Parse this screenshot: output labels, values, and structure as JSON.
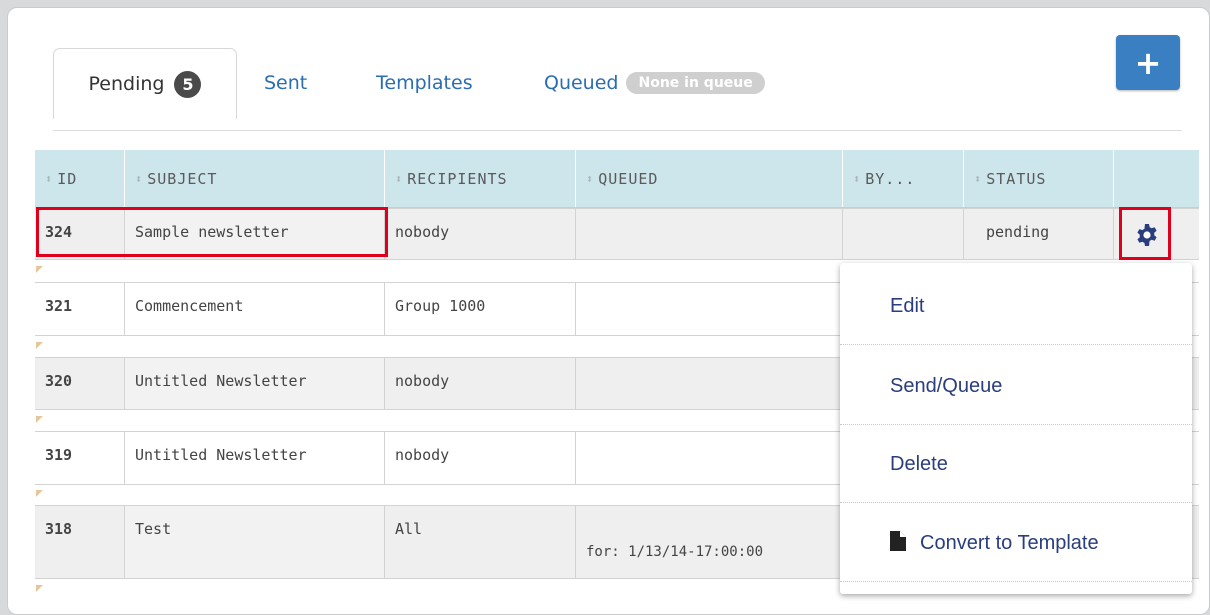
{
  "tabs": {
    "pending": {
      "label": "Pending",
      "count": "5"
    },
    "sent": {
      "label": "Sent"
    },
    "templates": {
      "label": "Templates"
    },
    "queued": {
      "label": "Queued",
      "pill": "None in queue"
    }
  },
  "add_button": {
    "label": "+"
  },
  "table": {
    "headers": [
      "ID",
      "SUBJECT",
      "RECIPIENTS",
      "QUEUED",
      "BY...",
      "STATUS"
    ],
    "rows": [
      {
        "id": "324",
        "subject": "Sample newsletter",
        "recipients": "nobody",
        "queued": "",
        "by": "",
        "status": "pending"
      },
      {
        "id": "321",
        "subject": "Commencement",
        "recipients": "Group 1000",
        "queued": "",
        "by": "",
        "status": ""
      },
      {
        "id": "320",
        "subject": "Untitled Newsletter",
        "recipients": "nobody",
        "queued": "",
        "by": "",
        "status": ""
      },
      {
        "id": "319",
        "subject": "Untitled Newsletter",
        "recipients": "nobody",
        "queued": "",
        "by": "",
        "status": ""
      },
      {
        "id": "318",
        "subject": "Test",
        "recipients": "All",
        "queued": "for: 1/13/14-17:00:00",
        "by": "",
        "status": ""
      }
    ]
  },
  "menu": {
    "items": [
      {
        "label": "Edit"
      },
      {
        "label": "Send/Queue"
      },
      {
        "label": "Delete"
      },
      {
        "label": "Convert to Template",
        "icon": "document-icon"
      }
    ]
  },
  "colors": {
    "accent": "#3a7fc2",
    "header_bg": "#cde6ec",
    "menu_text": "#2a3d7c",
    "highlight": "#e0001b"
  }
}
